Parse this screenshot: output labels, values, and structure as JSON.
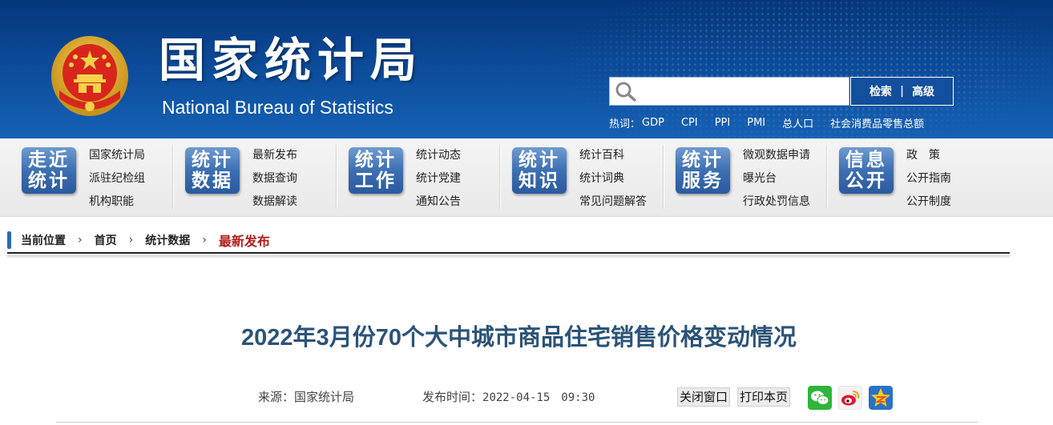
{
  "header": {
    "title_cn": "国家统计局",
    "title_en": "National Bureau of Statistics",
    "emblem_icon": "national-emblem",
    "colors": {
      "header_top": "#06367a",
      "header_bottom": "#1661b4",
      "accent": "#2b6cb8"
    }
  },
  "search": {
    "placeholder": "",
    "search_label": "检索",
    "separator": "|",
    "advanced_label": "高级",
    "hot_label": "热词：",
    "hot_words": [
      "GDP",
      "CPI",
      "PPI",
      "PMI",
      "总人口",
      "社会消费品零售总额"
    ]
  },
  "nav": [
    {
      "badge": [
        "走近",
        "统计"
      ],
      "links": [
        "国家统计局",
        "派驻纪检组",
        "机构职能"
      ]
    },
    {
      "badge": [
        "统计",
        "数据"
      ],
      "links": [
        "最新发布",
        "数据查询",
        "数据解读"
      ]
    },
    {
      "badge": [
        "统计",
        "工作"
      ],
      "links": [
        "统计动态",
        "统计党建",
        "通知公告"
      ]
    },
    {
      "badge": [
        "统计",
        "知识"
      ],
      "links": [
        "统计百科",
        "统计词典",
        "常见问题解答"
      ]
    },
    {
      "badge": [
        "统计",
        "服务"
      ],
      "links": [
        "微观数据申请",
        "曝光台",
        "行政处罚信息"
      ]
    },
    {
      "badge": [
        "信息",
        "公开"
      ],
      "links": [
        "政　策",
        "公开指南",
        "公开制度"
      ]
    }
  ],
  "breadcrumb": {
    "label": "当前位置",
    "items": [
      "首页",
      "统计数据",
      "最新发布"
    ],
    "arrow": "›"
  },
  "article": {
    "title": "2022年3月份70个大中城市商品住宅销售价格变动情况",
    "source_label": "来源：",
    "source": "国家统计局",
    "time_label": "发布时间：",
    "time": "2022-04-15　09:30",
    "close_label": "关闭窗口",
    "print_label": "打印本页",
    "share_icons": [
      "wechat-icon",
      "weibo-icon",
      "qzone-icon"
    ]
  }
}
